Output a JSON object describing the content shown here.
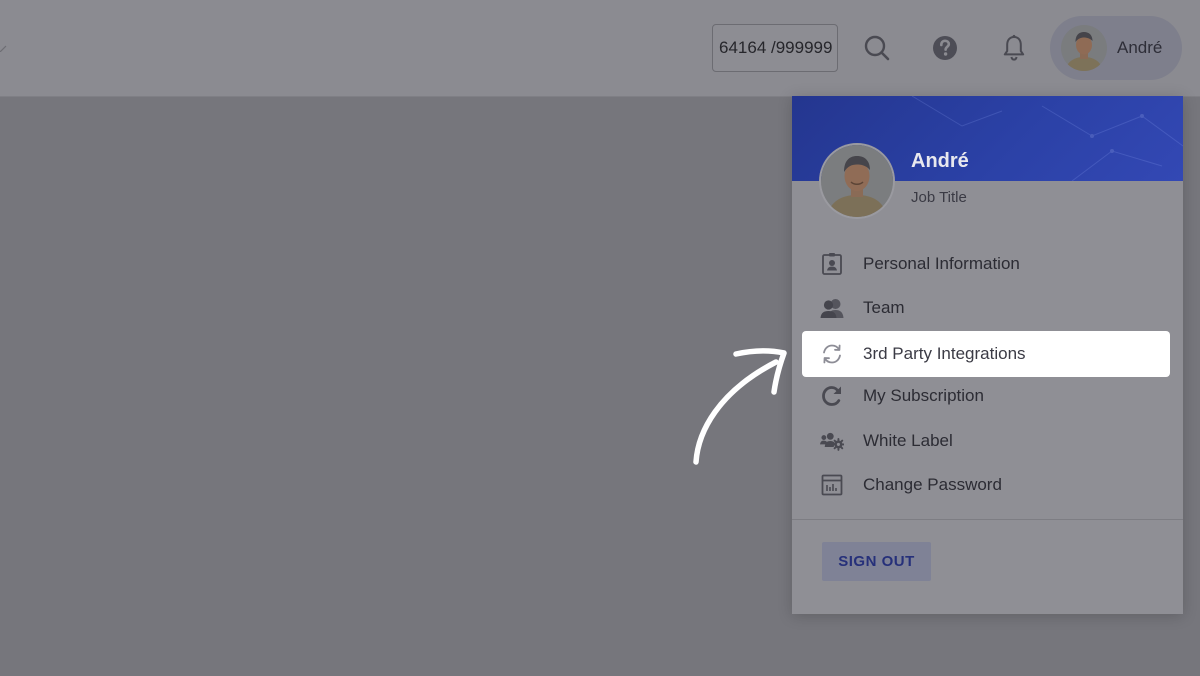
{
  "header": {
    "credits_text": "64164 /999999",
    "user_name": "André"
  },
  "menu": {
    "user_name": "André",
    "job_title": "Job Title",
    "items": [
      {
        "label": "Personal Information",
        "icon": "id-card-icon"
      },
      {
        "label": "Team",
        "icon": "team-icon"
      },
      {
        "label": "3rd Party Integrations",
        "icon": "sync-icon",
        "highlighted": true
      },
      {
        "label": "My Subscription",
        "icon": "redo-icon"
      },
      {
        "label": "White Label",
        "icon": "users-cog-icon"
      },
      {
        "label": "Change Password",
        "icon": "calendar-grid-icon"
      }
    ],
    "sign_out_label": "SIGN OUT"
  },
  "colors": {
    "banner_blue": "#2b41a6",
    "sign_out_text": "#26307a",
    "highlight": "#ffffff"
  }
}
